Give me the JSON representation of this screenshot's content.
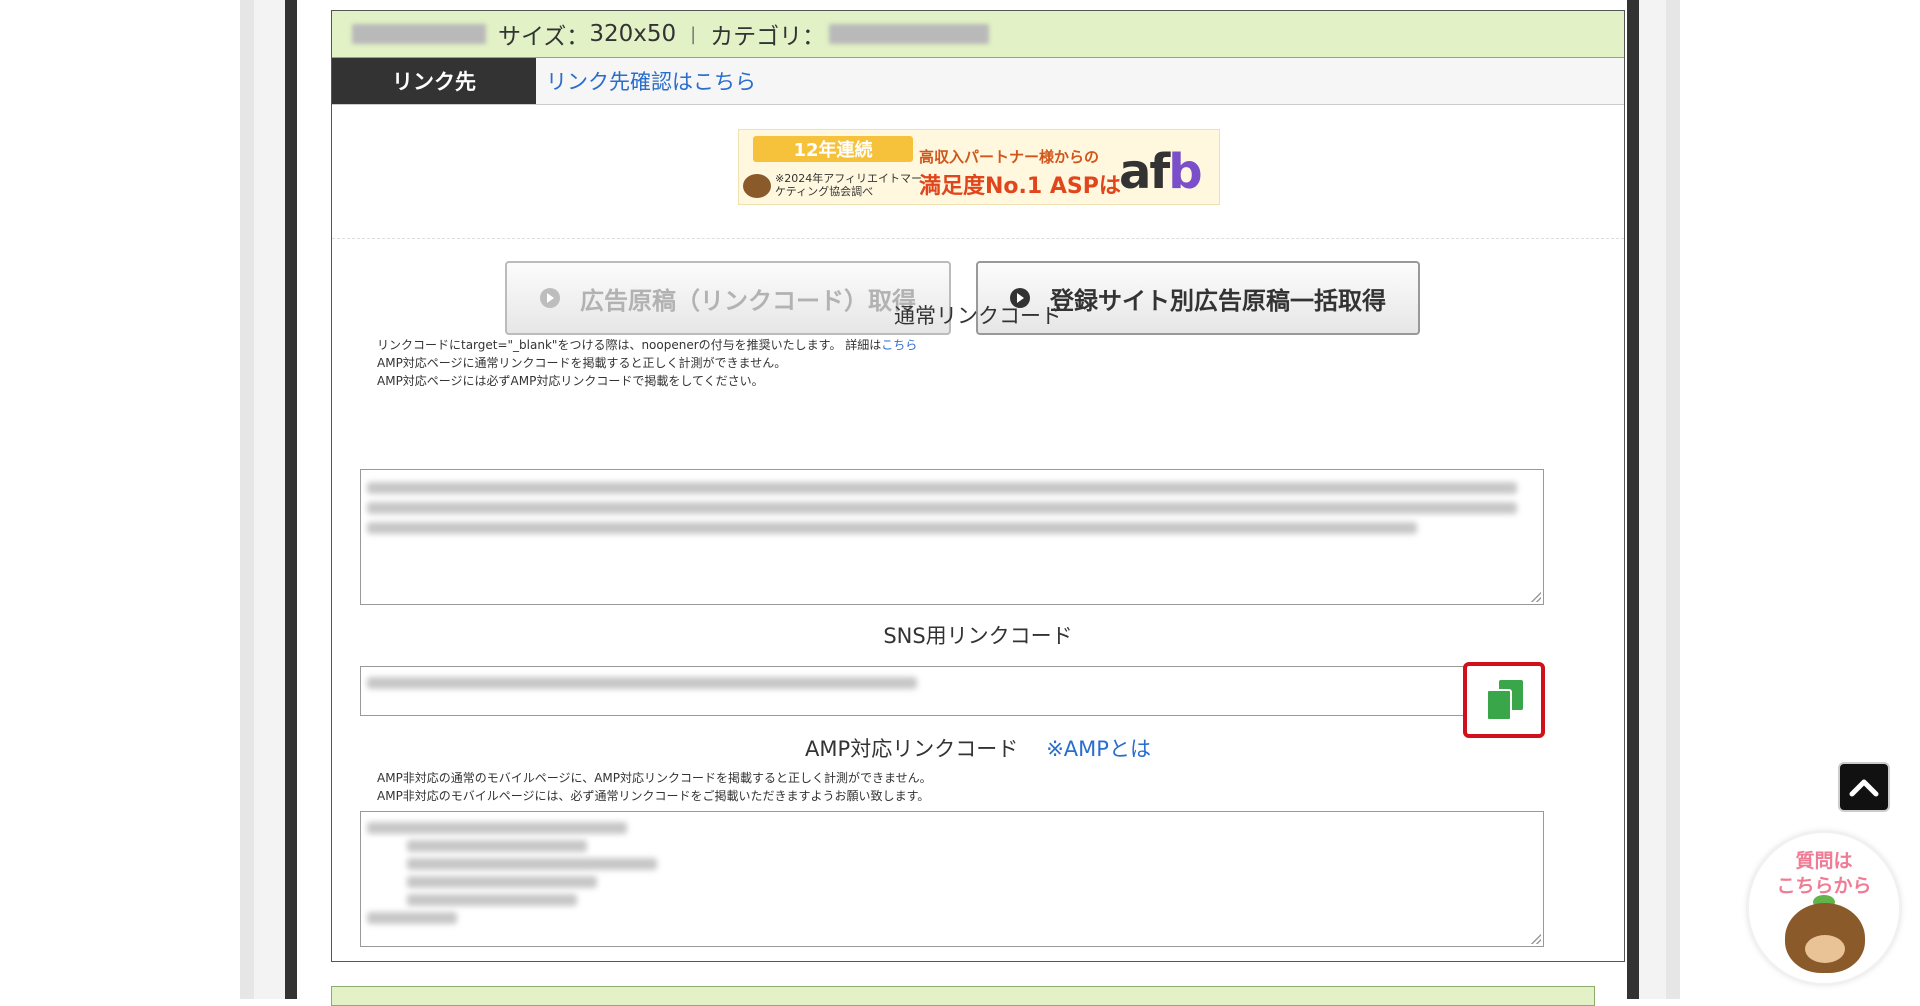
{
  "header": {
    "size_label": "サイズ：",
    "size_value": "320x50",
    "separator": "|",
    "category_label": "カテゴリ："
  },
  "link_row": {
    "label": "リンク先",
    "value": "リンク先確認はこちら"
  },
  "banner": {
    "badge": "12年連続",
    "sub": "※2024年アフィリエイトマーケティング協会調べ",
    "main1": "高収入パートナー様からの",
    "main2": "満足度No.1 ASPは",
    "logo_a": "af",
    "logo_b": "b"
  },
  "buttons": {
    "get_code": "広告原稿（リンクコード）取得",
    "bulk_get": "登録サイト別広告原稿一括取得"
  },
  "normal_link": {
    "title": "通常リンクコード",
    "note1_prefix": "リンクコードにtarget=\"_blank\"をつける際は、noopenerの付与を推奨いたします。 詳細は",
    "note1_link": "こちら",
    "note2": "AMP対応ページに通常リンクコードを掲載すると正しく計測ができません。",
    "note3": "AMP対応ページには必ずAMP対応リンクコードで掲載をしてください。"
  },
  "sns_link": {
    "title": "SNS用リンクコード"
  },
  "amp_link": {
    "title": "AMP対応リンクコード",
    "about_link": "※AMPとは",
    "note1": "AMP非対応の通常のモバイルページに、AMP対応リンクコードを掲載すると正しく計測ができません。",
    "note2": "AMP非対応のモバイルページには、必ず通常リンクコードをご掲載いただきますようお願い致します。"
  },
  "help": {
    "line1": "質問は",
    "line2": "こちらから"
  },
  "icons": {
    "copy": "copy-icon",
    "scroll_top": "chevron-up-icon"
  },
  "colors": {
    "header_bg": "#e2f1c6",
    "link_blue": "#2a6ecc",
    "copy_green": "#3aa64a",
    "highlight_red": "#d0101a"
  }
}
